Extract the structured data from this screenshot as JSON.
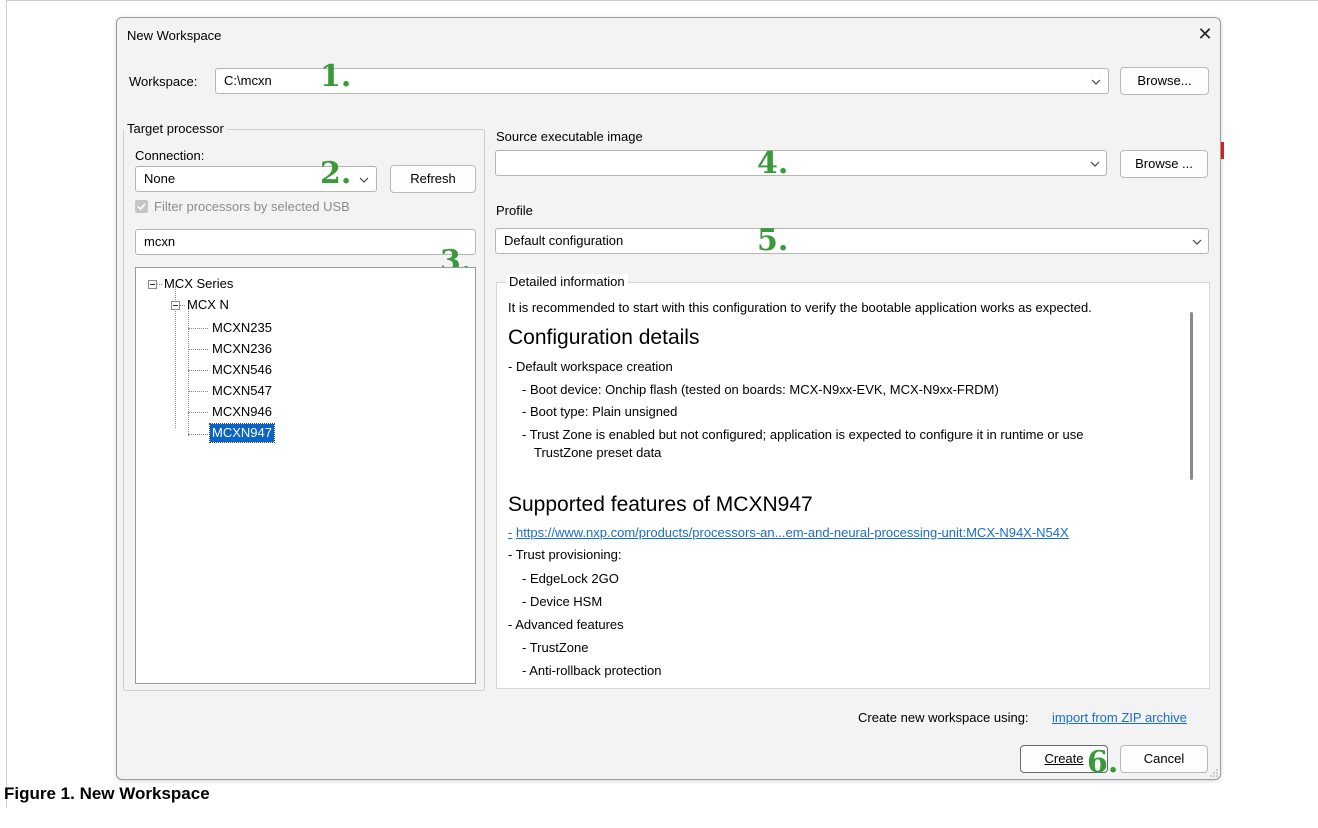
{
  "dialog": {
    "title": "New Workspace"
  },
  "workspace": {
    "label": "Workspace:",
    "value": "C:\\mcxn",
    "browse_label": "Browse..."
  },
  "target": {
    "legend": "Target processor",
    "connection_label": "Connection:",
    "connection_value": "None",
    "refresh_label": "Refresh",
    "filter_label": "Filter processors by selected USB",
    "search_value": "mcxn",
    "tree": {
      "root": "MCX Series",
      "family": "MCX N",
      "items": [
        "MCXN235",
        "MCXN236",
        "MCXN546",
        "MCXN547",
        "MCXN946",
        "MCXN947"
      ],
      "selected": "MCXN947"
    }
  },
  "source": {
    "label": "Source executable image",
    "value": "",
    "browse_label": "Browse ..."
  },
  "profile": {
    "label": "Profile",
    "value": "Default configuration"
  },
  "details": {
    "legend": "Detailed information",
    "intro": "It is recommended to start with this configuration to verify the bootable application works as expected.",
    "heading1": "Configuration details",
    "lines": [
      "- Default workspace creation",
      "- Boot device: Onchip flash (tested on boards: MCX-N9xx-EVK, MCX-N9xx-FRDM)",
      "- Boot type: Plain unsigned",
      "- Trust Zone is enabled but not configured; application is expected to configure it in runtime or use",
      "TrustZone preset data"
    ],
    "heading2": "Supported features of MCXN947",
    "link_prefix": "-",
    "link": "https://www.nxp.com/products/processors-an...em-and-neural-processing-unit:MCX-N94X-N54X",
    "features": [
      "- Trust provisioning:",
      "- EdgeLock 2GO",
      "- Device HSM",
      "- Advanced features",
      "- TrustZone",
      "- Anti-rollback protection"
    ]
  },
  "footer": {
    "create_using": "Create new workspace using:",
    "import_link": "import from ZIP archive",
    "create_label": "Create",
    "cancel_label": "Cancel"
  },
  "annotations": [
    "1.",
    "2.",
    "3.",
    "4.",
    "5.",
    "6."
  ],
  "caption": "Figure 1.  New Workspace",
  "colors": {
    "annotation": "#3a9a3a",
    "selection": "#0b64c8",
    "link": "#1a6dcc"
  }
}
